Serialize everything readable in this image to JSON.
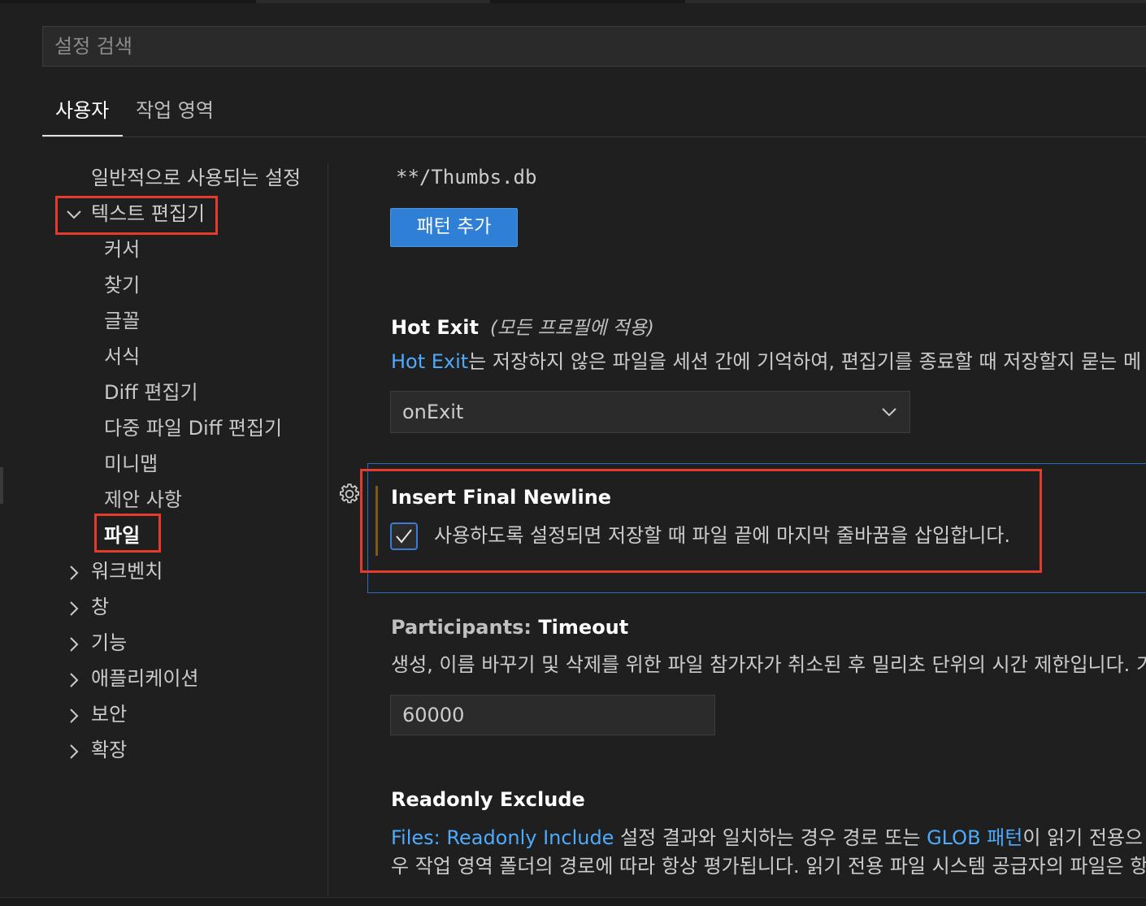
{
  "search": {
    "placeholder": "설정 검색",
    "value": ""
  },
  "tabs": [
    {
      "label": "사용자",
      "active": true
    },
    {
      "label": "작업 영역",
      "active": false
    }
  ],
  "toc": {
    "common": "일반적으로 사용되는 설정",
    "text_editor": "텍스트 편집기",
    "text_editor_children": [
      "커서",
      "찾기",
      "글꼴",
      "서식",
      "Diff 편집기",
      "다중 파일 Diff 편집기",
      "미니맵",
      "제안 사항",
      "파일"
    ],
    "collapsed": [
      "워크벤치",
      "창",
      "기능",
      "애플리케이션",
      "보안",
      "확장"
    ]
  },
  "exclude_pattern": "**/Thumbs.db",
  "add_pattern_label": "패턴 추가",
  "hot_exit": {
    "title": "Hot Exit",
    "scope": "(모든 프로필에 적용)",
    "desc_link": "Hot Exit",
    "desc_rest": "는 저장하지 않은 파일을 세션 간에 기억하여, 편집기를 종료할 때 저장할지 묻는 메",
    "value": "onExit"
  },
  "insert_final_newline": {
    "title": "Insert Final Newline",
    "desc": "사용하도록 설정되면 저장할 때 파일 끝에 마지막 줄바꿈을 삽입합니다.",
    "checked": true
  },
  "participants_timeout": {
    "category": "Participants: ",
    "title": "Timeout",
    "desc": "생성, 이름 바꾸기 및 삭제를 위한 파일 참가자가 취소된 후 밀리초 단위의 시간 제한입니다. 기",
    "value": "60000"
  },
  "readonly_exclude": {
    "title": "Readonly Exclude",
    "line1_link1": "Files: Readonly Include",
    "line1_mid": " 설정 결과와 일치하는 경우 경로 또는 ",
    "line1_link2": "GLOB 패턴",
    "line1_rest": "이 읽기 전용으",
    "line2": "우 작업 영역 폴더의 경로에 따라 항상 평가됩니다. 읽기 전용 파일 시스템 공급자의 파일은 항"
  },
  "colors": {
    "accent": "#2f7fd6",
    "link": "#4daafc",
    "highlight": "#e53b2c",
    "background": "#1f1f1f"
  }
}
